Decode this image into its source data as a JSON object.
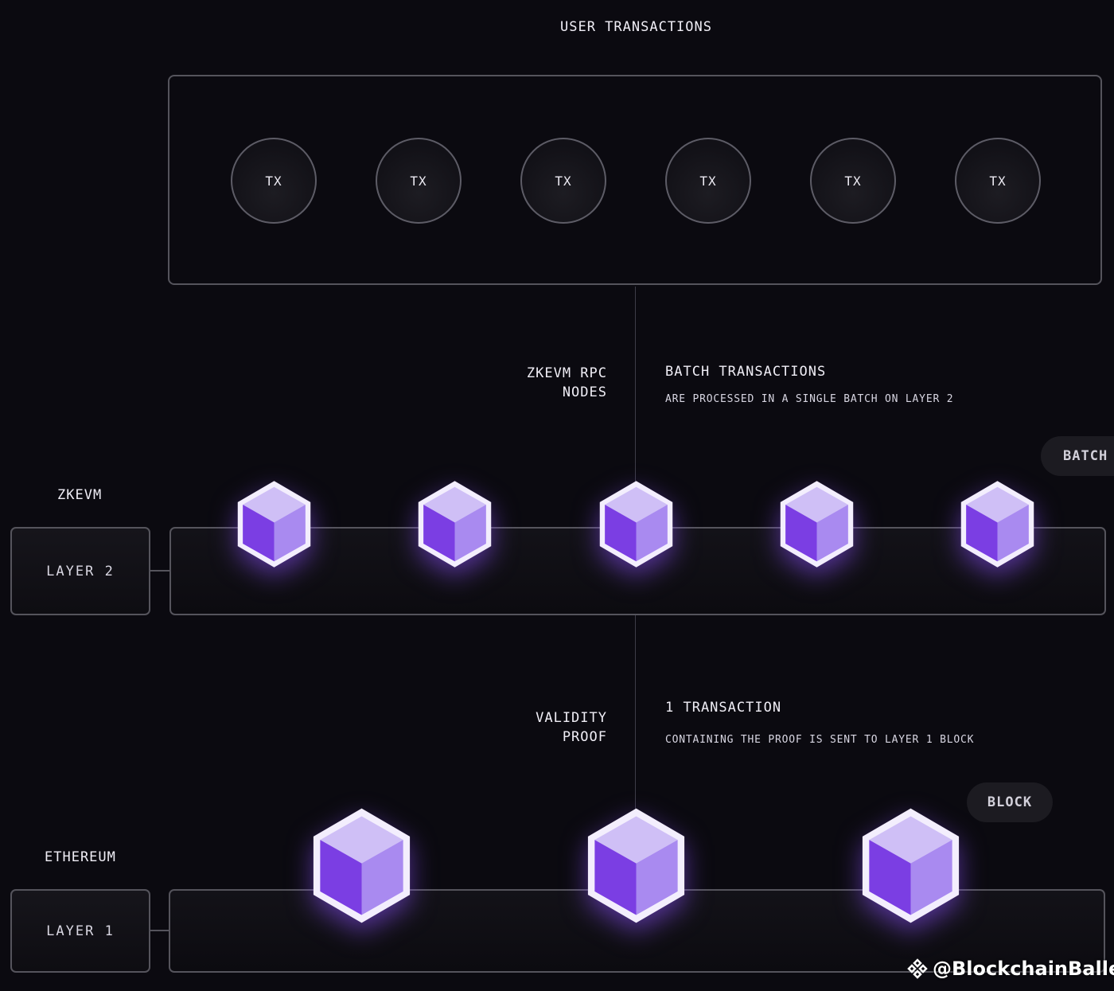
{
  "top": {
    "title": "USER TRANSACTIONS",
    "tx_label": "TX"
  },
  "rpc": {
    "left_label_line1": "ZKEVM RPC",
    "left_label_line2": "NODES",
    "heading": "BATCH TRANSACTIONS",
    "subtext": "ARE PROCESSED IN A SINGLE BATCH ON LAYER 2"
  },
  "layer2": {
    "network_label": "ZKEVM",
    "layer_label": "LAYER 2",
    "pill": "BATCH"
  },
  "proof": {
    "left_label_line1": "VALIDITY",
    "left_label_line2": "PROOF",
    "heading": "1 TRANSACTION",
    "subtext": "CONTAINING THE PROOF IS SENT TO LAYER 1 BLOCK"
  },
  "layer1": {
    "network_label": "ETHEREUM",
    "layer_label": "LAYER 1",
    "pill": "BLOCK"
  },
  "watermark": {
    "text": "@BlockchainBaller"
  },
  "colors": {
    "cube_top": "#cfbff6",
    "cube_left": "#7b3ee3",
    "cube_right": "#a98af0",
    "background": "#0b0a10"
  }
}
